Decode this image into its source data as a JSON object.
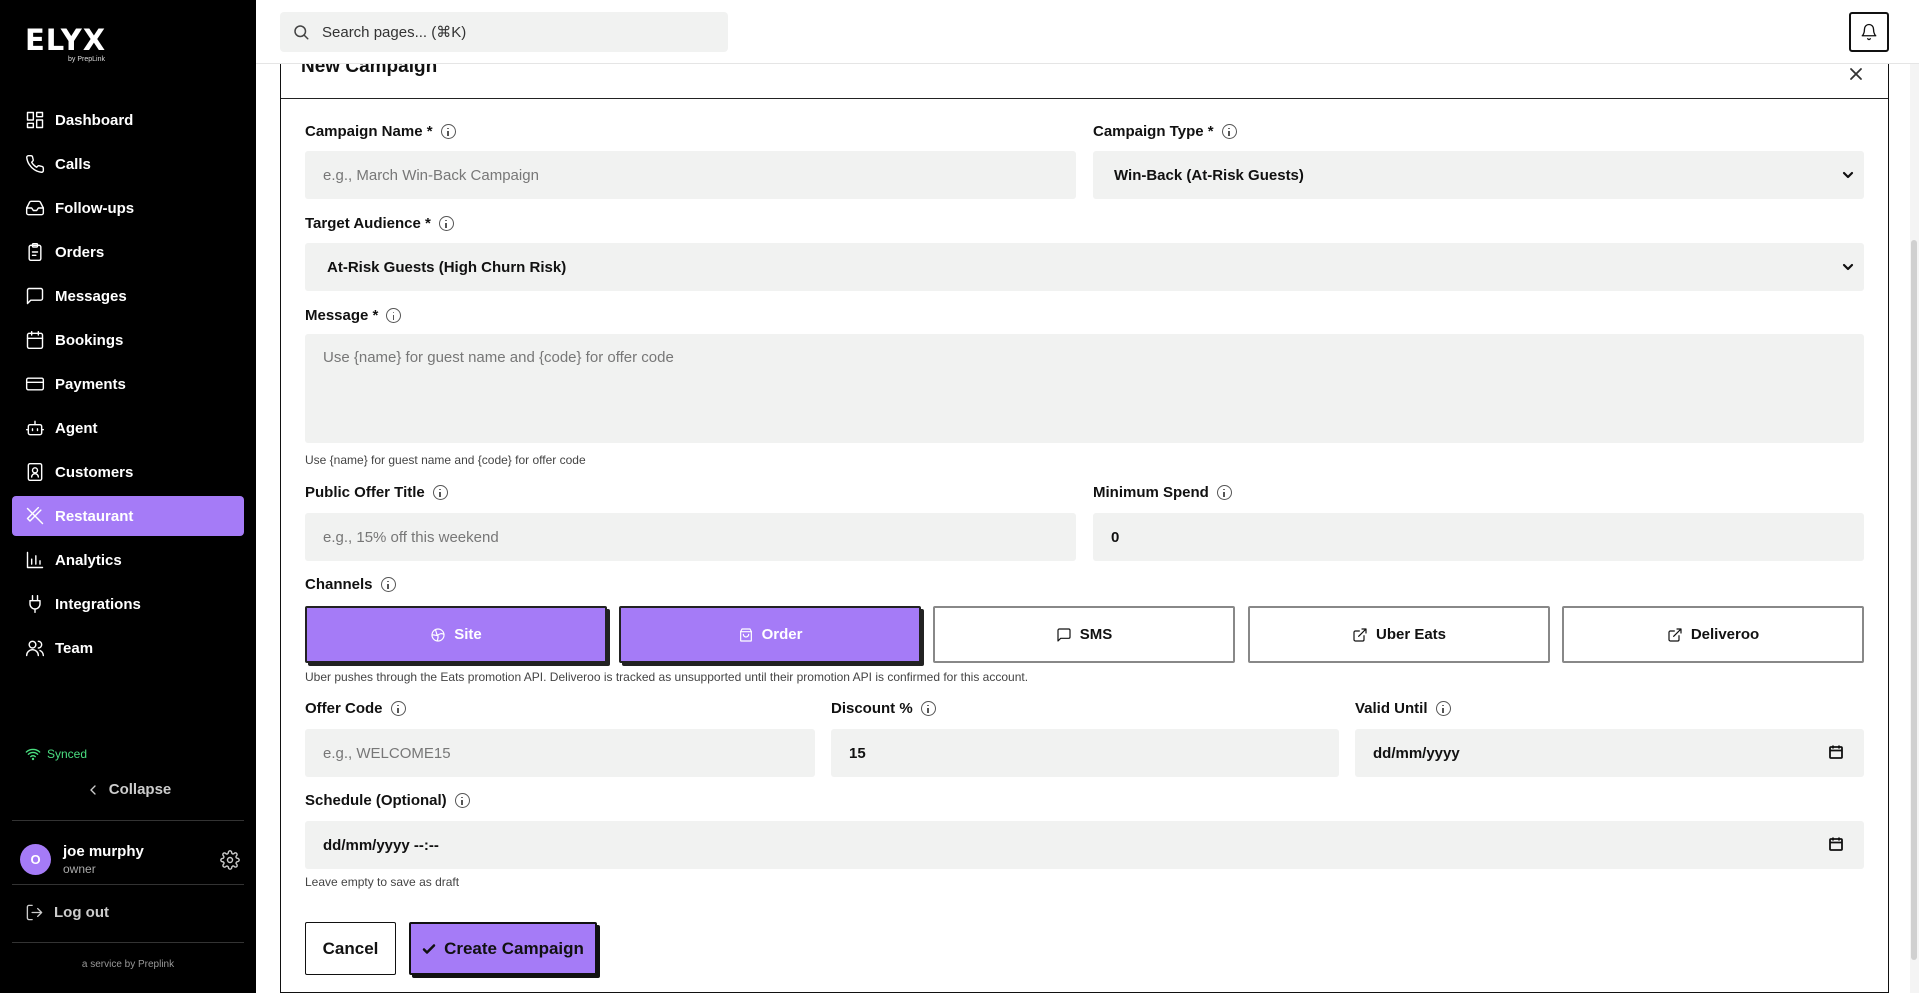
{
  "app": {
    "logo": "ELYX",
    "logo_sub": "by PrepLink",
    "footer_note": "a service by Preplink"
  },
  "sidebar": {
    "items": [
      {
        "label": "Dashboard",
        "icon": "dashboard-icon"
      },
      {
        "label": "Calls",
        "icon": "phone-icon"
      },
      {
        "label": "Follow-ups",
        "icon": "inbox-icon"
      },
      {
        "label": "Orders",
        "icon": "clipboard-icon"
      },
      {
        "label": "Messages",
        "icon": "message-icon"
      },
      {
        "label": "Bookings",
        "icon": "calendar-icon"
      },
      {
        "label": "Payments",
        "icon": "credit-card-icon"
      },
      {
        "label": "Agent",
        "icon": "bot-icon"
      },
      {
        "label": "Customers",
        "icon": "contact-icon"
      },
      {
        "label": "Restaurant",
        "icon": "utensils-icon",
        "active": true
      },
      {
        "label": "Analytics",
        "icon": "bar-chart-icon"
      },
      {
        "label": "Integrations",
        "icon": "plug-icon"
      },
      {
        "label": "Team",
        "icon": "users-icon"
      }
    ],
    "status": "Synced",
    "collapse_label": "Collapse",
    "user": {
      "initial": "O",
      "name": "joe murphy",
      "role": "owner"
    },
    "logout_label": "Log out"
  },
  "topbar": {
    "search_placeholder": "Search pages... (⌘K)"
  },
  "modal": {
    "title": "New Campaign",
    "campaign_name": {
      "label": "Campaign Name *",
      "placeholder": "e.g., March Win-Back Campaign"
    },
    "campaign_type": {
      "label": "Campaign Type *",
      "value": "Win-Back (At-Risk Guests)"
    },
    "target_audience": {
      "label": "Target Audience *",
      "value": "At-Risk Guests (High Churn Risk)"
    },
    "message": {
      "label": "Message *",
      "placeholder": "Use {name} for guest name and {code} for offer code",
      "hint": "Use {name} for guest name and {code} for offer code"
    },
    "public_offer_title": {
      "label": "Public Offer Title",
      "placeholder": "e.g., 15% off this weekend"
    },
    "minimum_spend": {
      "label": "Minimum Spend",
      "value": "0"
    },
    "channels": {
      "label": "Channels",
      "options": [
        {
          "label": "Site",
          "icon": "globe-icon",
          "selected": true
        },
        {
          "label": "Order",
          "icon": "shopping-bag-icon",
          "selected": true
        },
        {
          "label": "SMS",
          "icon": "message-icon",
          "selected": false
        },
        {
          "label": "Uber Eats",
          "icon": "external-link-icon",
          "selected": false
        },
        {
          "label": "Deliveroo",
          "icon": "external-link-icon",
          "selected": false
        }
      ],
      "hint": "Uber pushes through the Eats promotion API. Deliveroo is tracked as unsupported until their promotion API is confirmed for this account."
    },
    "offer_code": {
      "label": "Offer Code",
      "placeholder": "e.g., WELCOME15"
    },
    "discount": {
      "label": "Discount %",
      "value": "15"
    },
    "valid_until": {
      "label": "Valid Until",
      "value": "dd/mm/yyyy"
    },
    "schedule": {
      "label": "Schedule (Optional)",
      "value": "dd/mm/yyyy --:--",
      "hint": "Leave empty to save as draft"
    },
    "cancel_label": "Cancel",
    "create_label": "Create Campaign"
  },
  "colors": {
    "accent": "#a57bf7",
    "sidebar_bg": "#000000",
    "input_bg": "#f1f2f1",
    "synced": "#4ade80"
  }
}
